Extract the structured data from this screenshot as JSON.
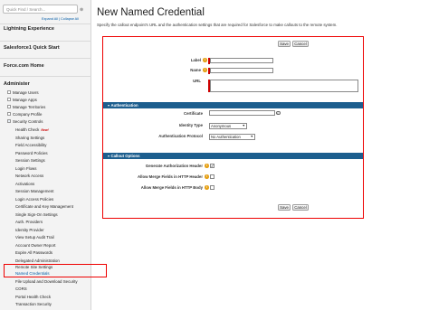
{
  "sidebar": {
    "quick_find_placeholder": "Quick Find / Search...",
    "expand_collapse": "Expand All | Collapse All",
    "sections": [
      {
        "label": "Lightning Experience"
      },
      {
        "label": "Salesforce1 Quick Start"
      },
      {
        "label": "Force.com Home"
      },
      {
        "label": "Administer"
      }
    ],
    "admin_items": [
      "Manage Users",
      "Manage Apps",
      "Manage Territories",
      "Company Profile",
      "Security Controls"
    ],
    "security_items": [
      "Health Check",
      "Sharing Settings",
      "Field Accessibility",
      "Password Policies",
      "Session Settings",
      "Login Flows",
      "Network Access",
      "Activations",
      "Session Management",
      "Login Access Policies",
      "Certificate and Key Management",
      "Single Sign-On Settings",
      "Auth. Providers",
      "Identity Provider",
      "View Setup Audit Trail",
      "Account Owner Report",
      "Expire All Passwords",
      "Delegated Administration",
      "Remote Site Settings",
      "Named Credentials",
      "File Upload and Download Security",
      "CORS",
      "Portal Health Check",
      "Transaction Security"
    ],
    "new_badge": "New!"
  },
  "main": {
    "title": "New Named Credential",
    "description": "Specify the callout endpoint's URL and the authentication settings that are required for Salesforce to make callouts to the remote system.",
    "save_label": "Save",
    "cancel_label": "Cancel",
    "fields": {
      "label": "Label",
      "name": "Name",
      "url": "URL"
    },
    "auth_section": "Authentication",
    "auth_fields": {
      "certificate": "Certificate",
      "identity_type": "Identity Type",
      "identity_type_value": "Anonymous",
      "auth_protocol": "Authentication Protocol",
      "auth_protocol_value": "No Authentication"
    },
    "callout_section": "Callout Options",
    "callout_fields": {
      "gen_auth_header": "Generate Authorization Header",
      "merge_header": "Allow Merge Fields in HTTP Header",
      "merge_body": "Allow Merge Fields in HTTP Body"
    },
    "checkbox_states": {
      "gen_auth_header": true,
      "merge_header": false,
      "merge_body": false
    },
    "info_glyph": "i",
    "check_glyph": "✓"
  }
}
